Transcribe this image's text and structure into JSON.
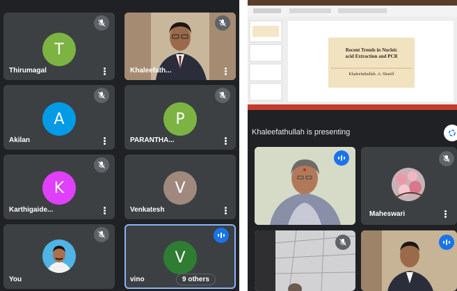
{
  "left_grid": {
    "participants": [
      {
        "name": "Thirumagal",
        "initial": "T",
        "color": "#7cb342"
      },
      {
        "name": "Khaleefath...",
        "initial": "",
        "color": ""
      },
      {
        "name": "Akilan",
        "initial": "A",
        "color": "#039be5"
      },
      {
        "name": "PARANTHA...",
        "initial": "P",
        "color": "#7cb342"
      },
      {
        "name": "Karthigaide...",
        "initial": "K",
        "color": "#e040fb"
      },
      {
        "name": "Venkatesh",
        "initial": "V",
        "color": "#a1887f"
      },
      {
        "name": "You",
        "initial": "",
        "color": ""
      },
      {
        "name": "vino",
        "initial": "V",
        "color": "#2e7d32"
      }
    ],
    "others_label": "9 others"
  },
  "right_panel": {
    "presenting_text": "Khaleefathullah is presenting",
    "slide": {
      "title_line1": "Recent Trends in Nucleic",
      "title_line2": "acid Extraction and PCR",
      "author": "Khaleefathullah .A. Shariff"
    },
    "participants": [
      {
        "name": ""
      },
      {
        "name": "Maheswari"
      },
      {
        "name": ""
      },
      {
        "name": ""
      }
    ]
  },
  "colors": {
    "tile_bg": "#3c4043",
    "page_bg": "#202124",
    "muted_icon": "#5f6368",
    "speaking_icon": "#1a73e8",
    "active_border": "#8ab4f8"
  },
  "icons": [
    "mic-off-icon",
    "more-vert-icon",
    "speaking-indicator-icon",
    "layout-icon"
  ]
}
